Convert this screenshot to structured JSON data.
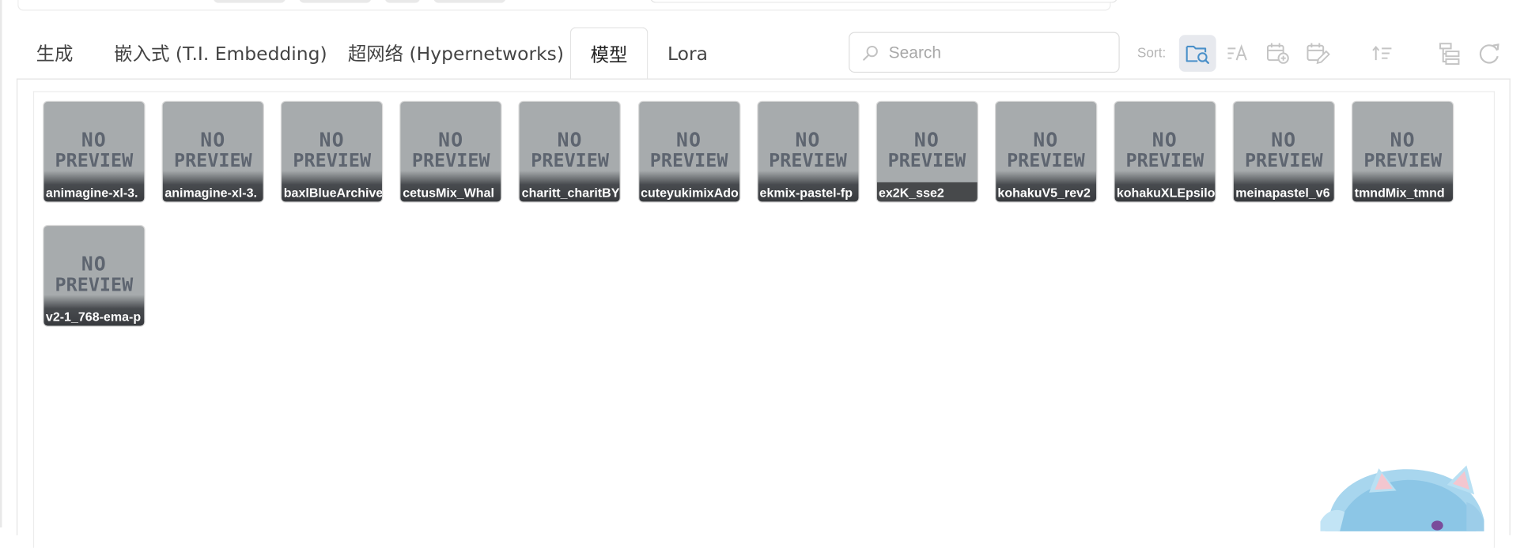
{
  "tabs": [
    {
      "label": "生成"
    },
    {
      "label": "嵌入式 (T.I. Embedding)"
    },
    {
      "label": "超网络 (Hypernetworks)"
    },
    {
      "label": "模型"
    },
    {
      "label": "Lora"
    }
  ],
  "active_tab": "模型",
  "search": {
    "placeholder": "Search",
    "value": ""
  },
  "sort": {
    "label": "Sort:"
  },
  "toolbar_icons": [
    "folder-search-icon",
    "sort-name-icon",
    "calendar-add-icon",
    "calendar-edit-icon",
    "sort-direction-icon",
    "tree-view-icon",
    "refresh-icon"
  ],
  "no_preview": {
    "line1": "NO",
    "line2": "PREVIEW"
  },
  "cards": [
    {
      "name": "animagine-xl-3."
    },
    {
      "name": "animagine-xl-3."
    },
    {
      "name": "baxlBlueArchive"
    },
    {
      "name": "cetusMix_Whal"
    },
    {
      "name": "charitt_charitBY"
    },
    {
      "name": "cuteyukimixAdo"
    },
    {
      "name": "ekmix-pastel-fp"
    },
    {
      "name": "ex2K_sse2"
    },
    {
      "name": "kohakuV5_rev2"
    },
    {
      "name": "kohakuXLEpsilo"
    },
    {
      "name": "meinapastel_v6"
    },
    {
      "name": "tmndMix_tmnd"
    },
    {
      "name": "v2-1_768-ema-p"
    }
  ],
  "colors": {
    "accent": "#4a90c9",
    "card_bg": "#a7abad",
    "active_btn_bg": "#e7e9ee"
  }
}
